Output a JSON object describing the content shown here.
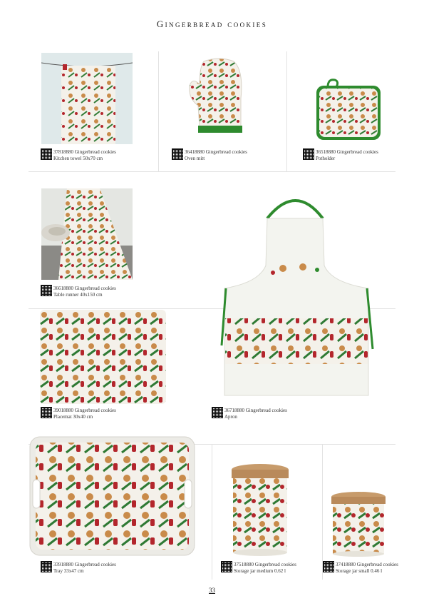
{
  "page": {
    "title": "Gingerbread cookies",
    "page_number": "33"
  },
  "products": [
    {
      "code": "37818880",
      "name": "Gingerbread cookies",
      "desc": "Kitchen towel 50x70 cm"
    },
    {
      "code": "36418880",
      "name": "Gingerbread cookies",
      "desc": "Oven mitt"
    },
    {
      "code": "36518880",
      "name": "Gingerbread cookies",
      "desc": "Potholder"
    },
    {
      "code": "36618880",
      "name": "Gingerbread cookies",
      "desc": "Table runner 40x150 cm"
    },
    {
      "code": "39018880",
      "name": "Gingerbread cookies",
      "desc": "Placemat 30x40 cm"
    },
    {
      "code": "36718880",
      "name": "Gingerbread cookies",
      "desc": "Apron"
    },
    {
      "code": "33918880",
      "name": "Gingerbread cookies",
      "desc": "Tray 33x47 cm"
    },
    {
      "code": "37518880",
      "name": "Gingerbread cookies",
      "desc": "Storage jar medium 0.62 l"
    },
    {
      "code": "37418880",
      "name": "Gingerbread cookies",
      "desc": "Storage jar small 0.46 l"
    }
  ],
  "colors": {
    "green_trim": "#2e8b2e",
    "red": "#b3262c",
    "cookie": "#c98b4a",
    "background": "#f4f1ea"
  }
}
